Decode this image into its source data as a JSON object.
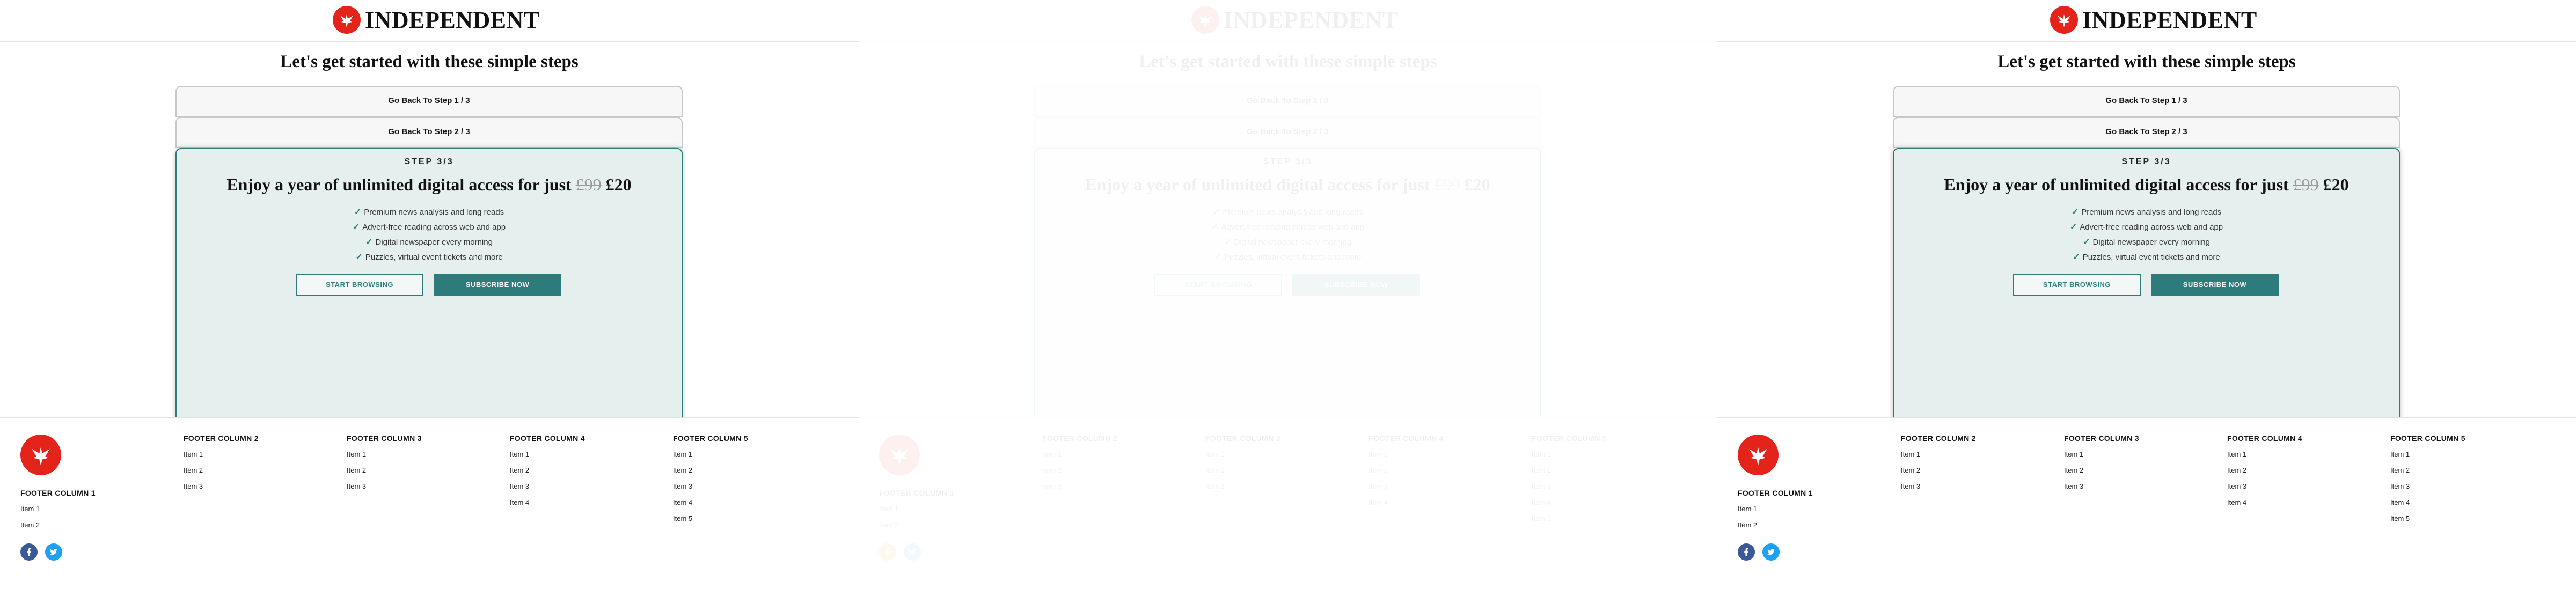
{
  "brand": "INDEPENDENT",
  "page_title": "Let's get started with these simple steps",
  "steps": {
    "step1_link": "Go Back To Step 1 / 3",
    "step2_link": "Go Back To Step 2 / 3",
    "current_label": "STEP 3/3"
  },
  "offer": {
    "headline_prefix": "Enjoy a year of unlimited digital access for just",
    "old_price": "£99",
    "new_price": "£20",
    "benefits": [
      "Premium news analysis and long reads",
      "Advert-free reading across web and app",
      "Digital newspaper every morning",
      "Puzzles, virtual event tickets and more"
    ],
    "browse_button": "START BROWSING",
    "subscribe_button": "SUBSCRIBE NOW"
  },
  "footer": {
    "columns": [
      {
        "title": "FOOTER COLUMN 1",
        "items": [
          "Item 1",
          "Item 2"
        ]
      },
      {
        "title": "FOOTER COLUMN 2",
        "items": [
          "Item 1",
          "Item 2",
          "Item 3"
        ]
      },
      {
        "title": "FOOTER COLUMN 3",
        "items": [
          "Item 1",
          "Item 2",
          "Item 3"
        ]
      },
      {
        "title": "FOOTER COLUMN 4",
        "items": [
          "Item 1",
          "Item 2",
          "Item 3",
          "Item 4"
        ]
      },
      {
        "title": "FOOTER COLUMN 5",
        "items": [
          "Item 1",
          "Item 2",
          "Item 3",
          "Item 4",
          "Item 5"
        ]
      }
    ],
    "social": [
      "facebook-icon",
      "twitter-icon"
    ]
  },
  "colors": {
    "brand_red": "#e4231b",
    "accent_teal": "#2e7b7b",
    "card_bg": "#e5efee",
    "facebook_blue": "#3b5998",
    "twitter_blue": "#1da1f2"
  }
}
